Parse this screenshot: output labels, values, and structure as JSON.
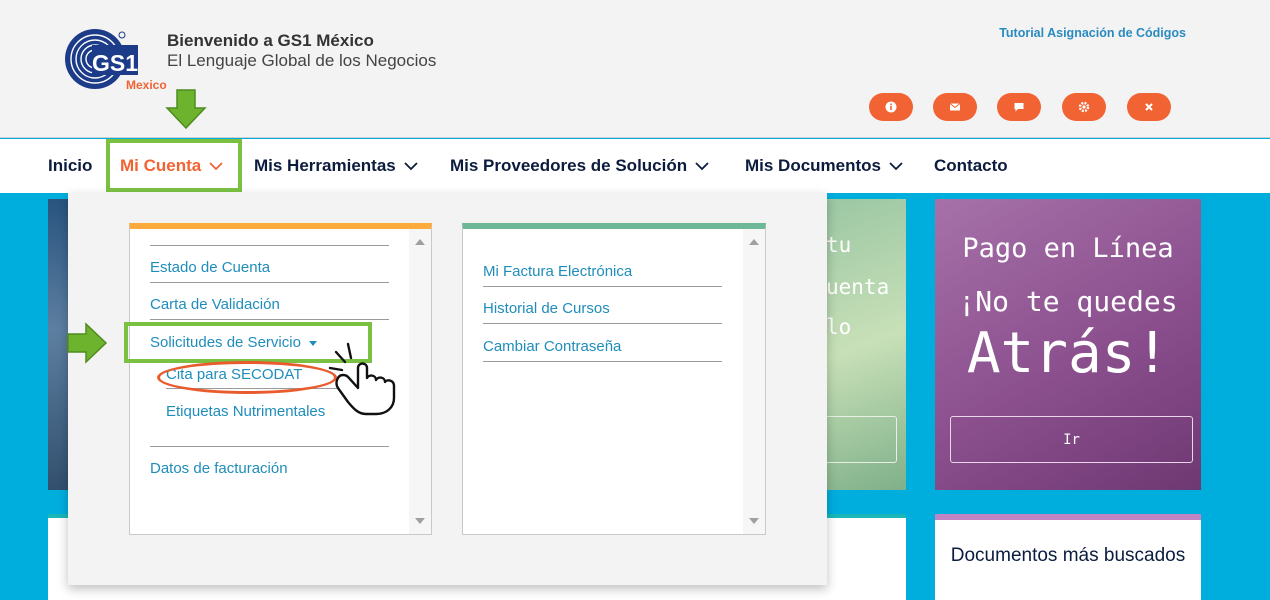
{
  "header": {
    "logo_text": "GS1",
    "logo_sub": "Mexico",
    "welcome": "Bienvenido a GS1 México",
    "tagline": "El Lenguaje Global de los Negocios",
    "tutorial_link": "Tutorial Asignación de Códigos",
    "icons": [
      "info-icon",
      "mail-icon",
      "chat-icon",
      "settings-icon",
      "close-icon"
    ]
  },
  "nav": {
    "items": [
      "Inicio",
      "Mi Cuenta",
      "Mis Herramientas",
      "Mis Proveedores de Solución",
      "Mis Documentos",
      "Contacto"
    ],
    "active": "Mi Cuenta"
  },
  "dropdown": {
    "left": {
      "items": [
        "Estado de Cuenta",
        "Carta de Validación",
        "Solicitudes de Servicio",
        "Cita para SECODAT",
        "Etiquetas Nutrimentales",
        "Datos de facturación"
      ]
    },
    "right": {
      "items": [
        "Mi Factura Electrónica",
        "Historial de Cursos",
        "Cambiar Contraseña"
      ]
    }
  },
  "cards": {
    "mid_text": [
      "tu",
      "uenta",
      "lo"
    ],
    "pay": {
      "line1": "Pago en Línea",
      "line2": "¡No te quedes",
      "line3": "Atrás!",
      "button": "Ir"
    },
    "docs_title": "Documentos más buscados"
  },
  "colors": {
    "accent": "#f26334",
    "highlight": "#7ac143",
    "link": "#1f8dbb",
    "nav_text": "#0c1c3e",
    "background": "#00aede"
  }
}
